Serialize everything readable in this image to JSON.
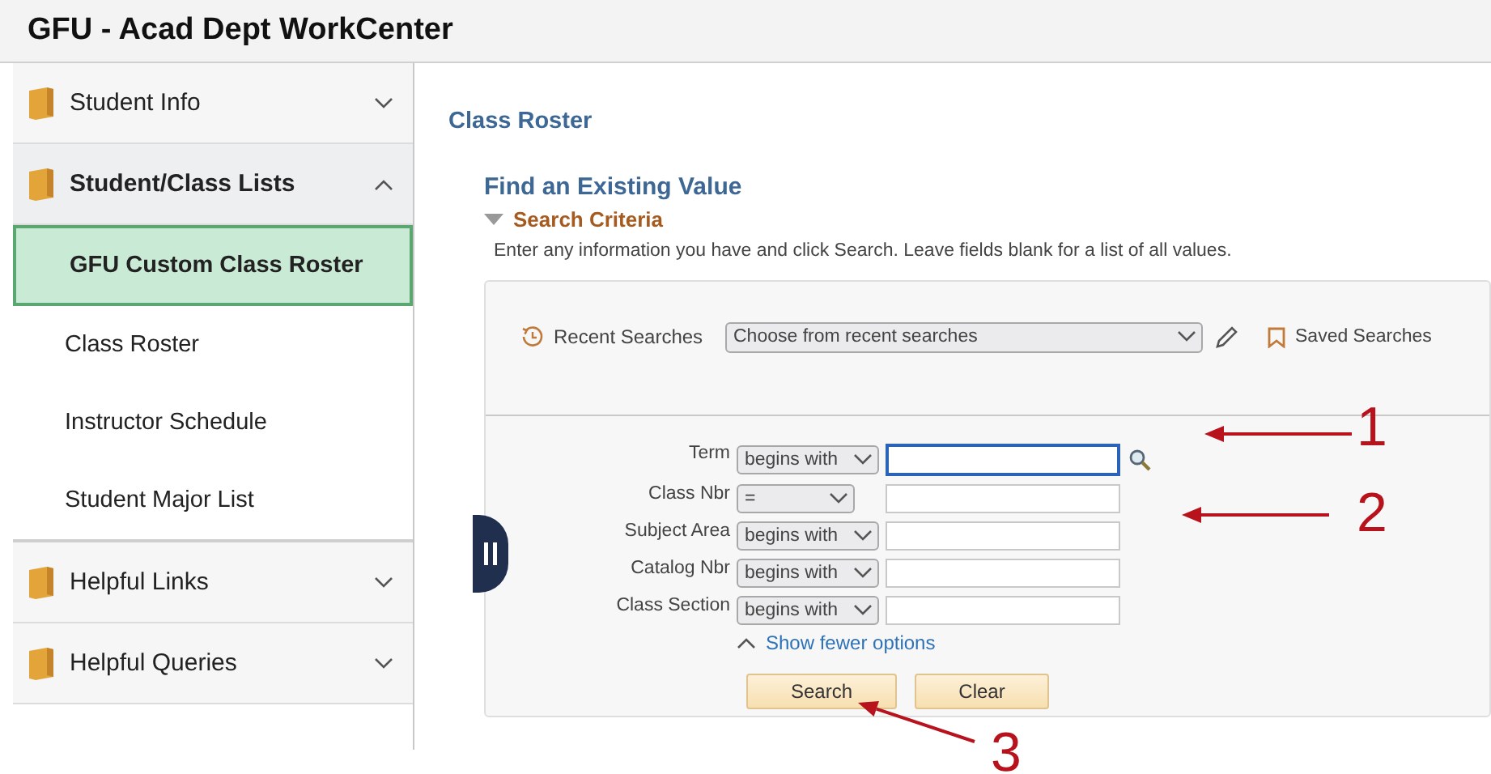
{
  "window": {
    "title": "GFU - Acad Dept WorkCenter"
  },
  "sidebar": {
    "groups": [
      {
        "label": "Student Info",
        "expanded": false
      },
      {
        "label": "Student/Class Lists",
        "expanded": true,
        "children": [
          {
            "label": "GFU Custom Class Roster",
            "selected": true
          },
          {
            "label": "Class Roster",
            "selected": false
          },
          {
            "label": "Instructor Schedule",
            "selected": false
          },
          {
            "label": "Student Major List",
            "selected": false
          }
        ]
      },
      {
        "label": "Helpful Links",
        "expanded": false
      },
      {
        "label": "Helpful Queries",
        "expanded": false
      }
    ]
  },
  "page": {
    "title": "Class Roster",
    "heading": "Find an Existing Value",
    "section": {
      "label": "Search Criteria",
      "expanded": true
    },
    "instructions": "Enter any information you have and click Search. Leave fields blank for a list of all values.",
    "recent_searches": {
      "label": "Recent Searches",
      "placeholder": "Choose from recent searches"
    },
    "saved_searches": {
      "label": "Saved Searches"
    },
    "fields": [
      {
        "label": "Term",
        "operator": "begins with",
        "focused": true,
        "lookup": true
      },
      {
        "label": "Class Nbr",
        "operator": "=",
        "focused": false
      },
      {
        "label": "Subject Area",
        "operator": "begins with",
        "focused": false
      },
      {
        "label": "Catalog Nbr",
        "operator": "begins with",
        "focused": false
      },
      {
        "label": "Class Section",
        "operator": "begins with",
        "focused": false
      }
    ],
    "toggle_link": "Show fewer options",
    "buttons": [
      "Search",
      "Clear"
    ]
  },
  "annotations": [
    "1",
    "2",
    "3"
  ]
}
